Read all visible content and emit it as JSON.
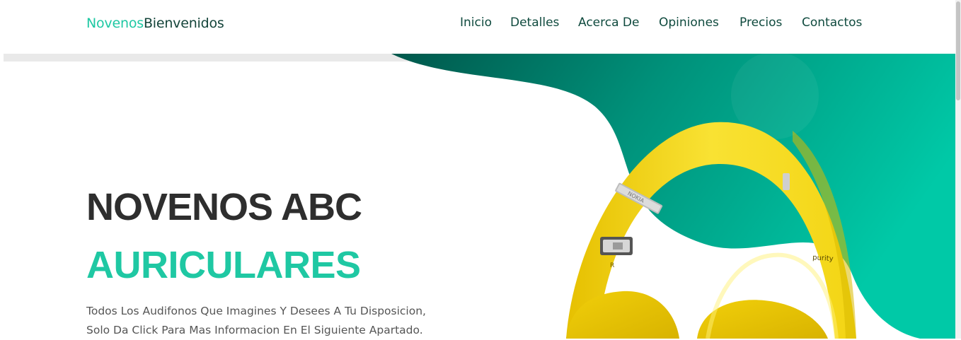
{
  "brand": {
    "part1": "Novenos",
    "part2": "Bienvenidos"
  },
  "nav": [
    "Inicio",
    "Detalles",
    "Acerca De",
    "Opiniones",
    "Precios",
    "Contactos"
  ],
  "hero": {
    "title_line1": "NOVENOS ABC",
    "title_line2": "AURICULARES",
    "description_line1": "Todos Los Audifonos Que Imagines Y Desees A Tu Disposicion,",
    "description_line2": "Solo Da Click Para Mas Informacion En El Siguiente Apartado."
  },
  "headphone": {
    "brand_label": "NOKIA",
    "model_label": "purity",
    "side_label": "R"
  },
  "colors": {
    "accent": "#1fc8a3",
    "dark_text": "#2e2e2e",
    "nav_text": "#0f4a3e",
    "wave_light": "#00c9a7",
    "wave_dark": "#00574b",
    "headphone_yellow": "#f7dc1e"
  }
}
